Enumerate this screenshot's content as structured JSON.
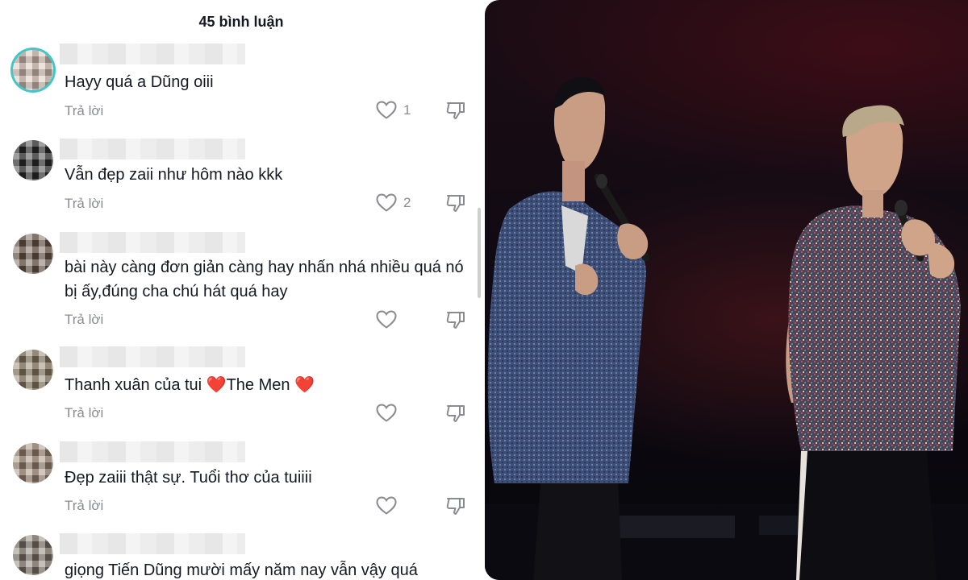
{
  "header": {
    "title": "45 bình luận"
  },
  "comments": [
    {
      "text": "Hayy quá a Dũng oiii",
      "reply": "Trả lời",
      "likes": "1"
    },
    {
      "text": "Vẫn đẹp zaii như hôm nào kkk",
      "reply": "Trả lời",
      "likes": "2"
    },
    {
      "text": "bài này càng đơn giản càng hay nhấn nhá nhiều quá nó bị ấy,đúng cha chú hát quá hay",
      "reply": "Trả lời",
      "likes": ""
    },
    {
      "text_before": "Thanh xuân của tui ",
      "heart1": "❤️",
      "text_mid": "The Men ",
      "heart2": "❤️",
      "reply": "Trả lời",
      "likes": ""
    },
    {
      "text": "Đẹp zaiii thật sự. Tuổi thơ của tuiiii",
      "reply": "Trả lời",
      "likes": ""
    },
    {
      "text": "giọng Tiến Dũng mười mấy năm nay vẫn vậy quá"
    }
  ],
  "icons": {
    "like": "heart-outline-icon",
    "dislike": "thumbs-down-icon"
  },
  "colors": {
    "text": "#161823",
    "muted": "#8a8b91",
    "avatar_ring": "#41c7c7",
    "heart": "#e02424"
  }
}
